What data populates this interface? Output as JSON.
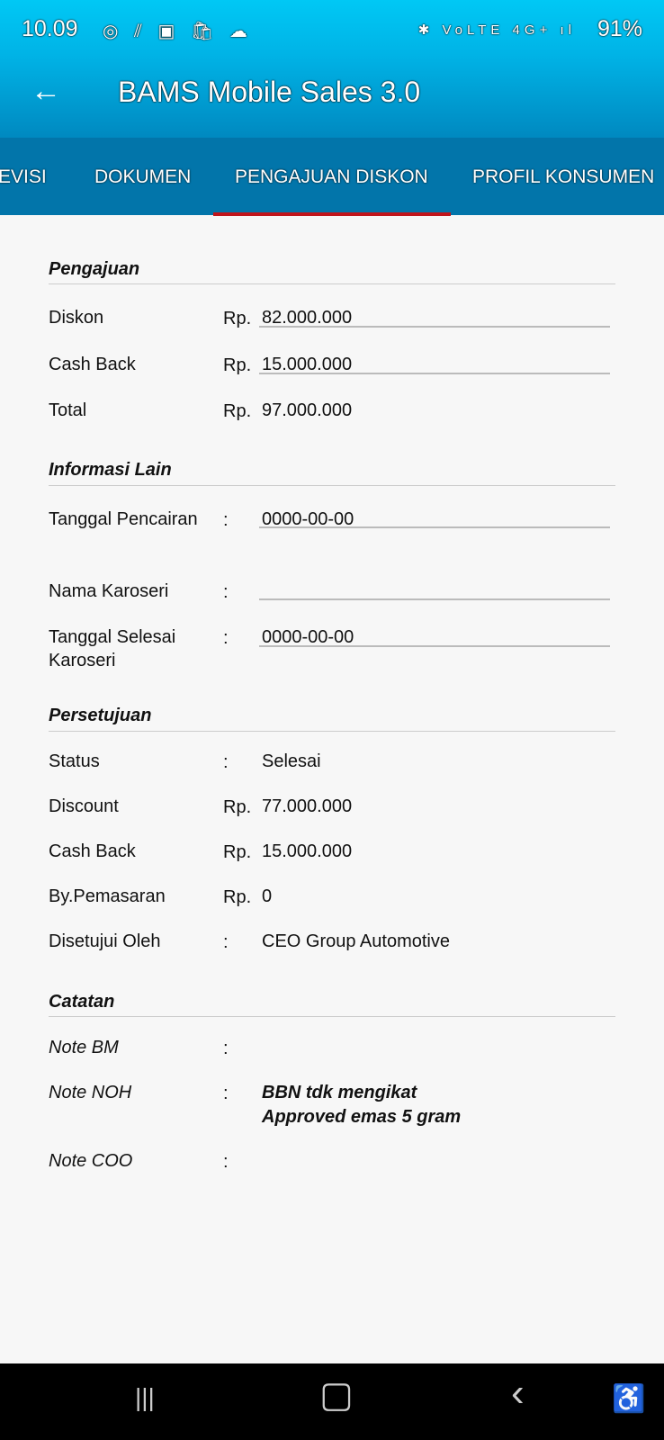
{
  "status_bar": {
    "time": "10.09",
    "battery": "91%",
    "left_icons": "◎ ⫽ ▣ 🛍 ☁",
    "right_icons": "✱ VoLTE 4G+ ıl"
  },
  "header": {
    "title": "BAMS Mobile Sales 3.0"
  },
  "tabs": [
    {
      "label": "EVISI"
    },
    {
      "label": "DOKUMEN"
    },
    {
      "label": "PENGAJUAN DISKON",
      "active": true
    },
    {
      "label": "PROFIL KONSUMEN"
    }
  ],
  "pengajuan": {
    "heading": "Pengajuan",
    "rows": [
      {
        "label": "Diskon",
        "prefix": "Rp.",
        "value": "82.000.000"
      },
      {
        "label": "Cash Back",
        "prefix": "Rp.",
        "value": "15.000.000"
      },
      {
        "label": "Total",
        "prefix": "Rp.",
        "value": "97.000.000"
      }
    ]
  },
  "informasi": {
    "heading": "Informasi Lain",
    "rows": [
      {
        "label": "Tanggal Pencairan",
        "prefix": ":",
        "value": "0000-00-00"
      },
      {
        "label": "Nama Karoseri",
        "prefix": ":",
        "value": ""
      },
      {
        "label": "Tanggal Selesai Karoseri",
        "prefix": ":",
        "value": "0000-00-00"
      }
    ]
  },
  "persetujuan": {
    "heading": "Persetujuan",
    "rows": [
      {
        "label": "Status",
        "prefix": ":",
        "value": "Selesai"
      },
      {
        "label": "Discount",
        "prefix": "Rp.",
        "value": "77.000.000"
      },
      {
        "label": "Cash Back",
        "prefix": "Rp.",
        "value": "15.000.000"
      },
      {
        "label": "By.Pemasaran",
        "prefix": "Rp.",
        "value": "0"
      },
      {
        "label": "Disetujui Oleh",
        "prefix": ":",
        "value": "CEO Group Automotive"
      }
    ]
  },
  "catatan": {
    "heading": "Catatan",
    "rows": [
      {
        "label": "Note BM",
        "prefix": ":",
        "value": ""
      },
      {
        "label": "Note NOH",
        "prefix": ":",
        "value": "BBN tdk mengikat",
        "value2": "Approved emas 5 gram"
      },
      {
        "label": "Note COO",
        "prefix": ":",
        "value": ""
      }
    ]
  },
  "nav": {
    "recent": "|||",
    "home": "▢",
    "back": "‹",
    "accessibility": "♿"
  }
}
